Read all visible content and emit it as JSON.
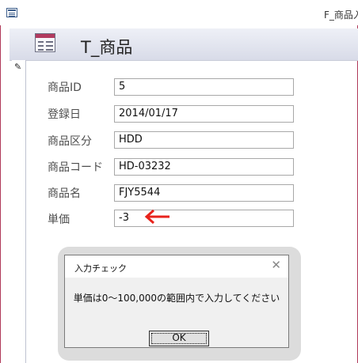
{
  "window": {
    "title": "F_商品入",
    "icon": "form-icon"
  },
  "header": {
    "title": "T_商品",
    "icon": "table-icon"
  },
  "record_selector": {
    "icon": "pencil-icon"
  },
  "fields": [
    {
      "label": "商品ID",
      "value": "5"
    },
    {
      "label": "登録日",
      "value": "2014/01/17"
    },
    {
      "label": "商品区分",
      "value": "HDD"
    },
    {
      "label": "商品コード",
      "value": "HD-03232"
    },
    {
      "label": "商品名",
      "value": "FJY5544"
    },
    {
      "label": "単価",
      "value": "-3"
    }
  ],
  "annotation": {
    "icon": "red-arrow-icon",
    "color": "#e8231c"
  },
  "dialog": {
    "title": "入力チェック",
    "message": "単価は0～100,000の範囲内で入力してください",
    "ok_label": "OK",
    "close_glyph": "✕"
  }
}
